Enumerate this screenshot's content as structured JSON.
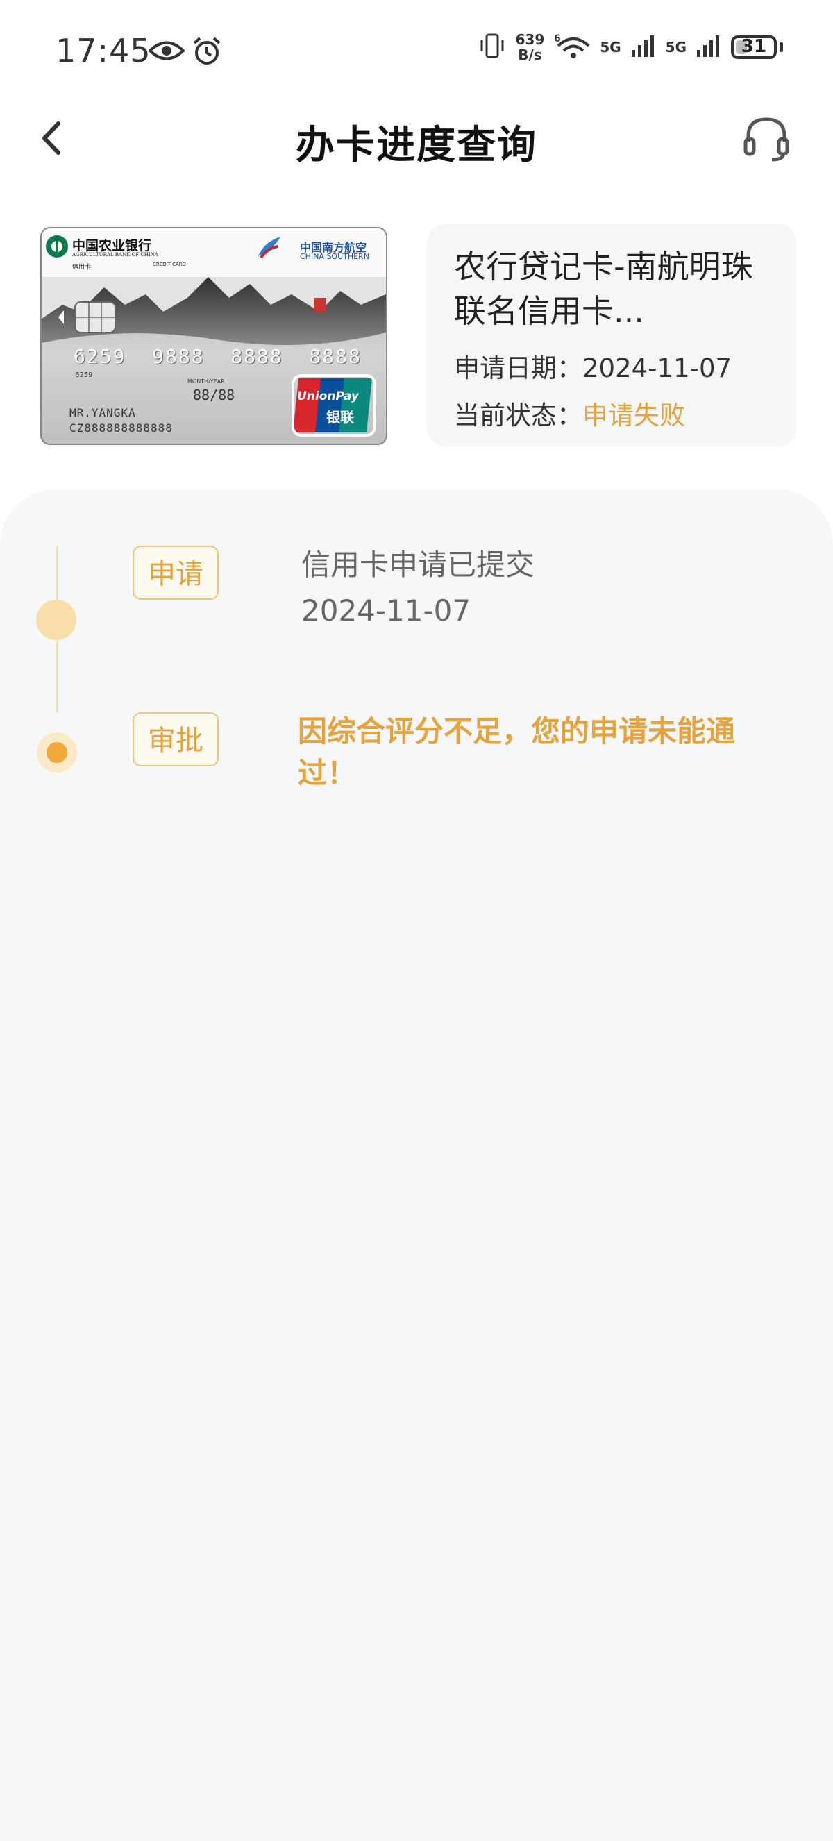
{
  "status_bar": {
    "time": "17:45",
    "net_speed_value": "639",
    "net_speed_unit": "B/s",
    "network_1": "5G",
    "network_2": "5G",
    "wifi_label": "6",
    "battery": "31",
    "battery_level": 0.31
  },
  "header": {
    "title": "办卡进度查询"
  },
  "card": {
    "bank_name": "中国农业银行",
    "bank_name_en": "AGRICULTURAL BANK OF CHINA",
    "card_type": "信用卡",
    "card_type_en": "CREDIT CARD",
    "airline_name": "中国南方航空",
    "airline_name_en": "CHINA SOUTHERN",
    "card_number": "6259  9888  8888  8888",
    "card_prefix": "6259",
    "valid_label": "MONTH/YEAR",
    "valid_thru": "88/88",
    "holder": "MR.YANGKA",
    "code_line": "CZ888888888888",
    "unionpay_en": "UnionPay",
    "unionpay_cn": "银联"
  },
  "application": {
    "card_name": "农行贷记卡-南航明珠联名信用卡...",
    "date_label": "申请日期：",
    "date_value": "2024-11-07",
    "status_label": "当前状态：",
    "status_value": "申请失败",
    "status_color": "#e6a23c"
  },
  "timeline": [
    {
      "tag": "申请",
      "text": "信用卡申请已提交",
      "date": "2024-11-07"
    },
    {
      "tag": "审批",
      "text": "因综合评分不足，您的申请未能通过！"
    }
  ]
}
